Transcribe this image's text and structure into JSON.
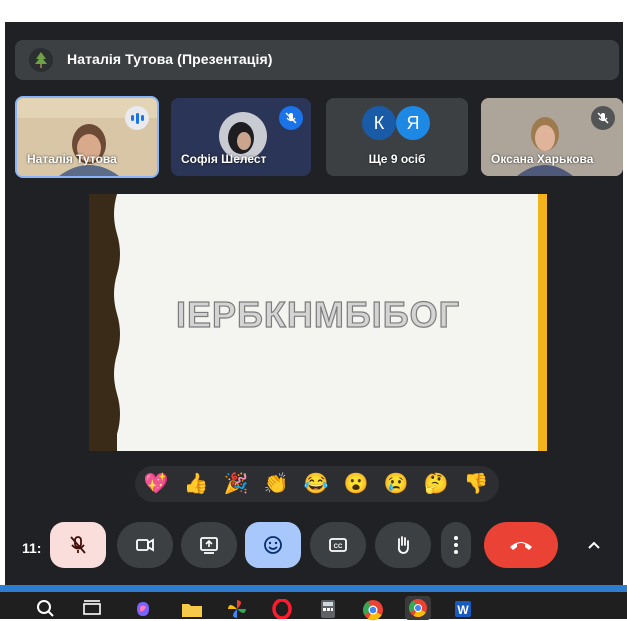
{
  "header": {
    "title": "Наталія Тутова (Презентація)",
    "presenter_icon": "tree-avatar-icon"
  },
  "participants": [
    {
      "name": "Наталія Тутова",
      "state": "speaking"
    },
    {
      "name": "Софія Шелест",
      "state": "muted"
    },
    {
      "name": "Ще 9 осіб",
      "avatars": [
        "К",
        "Я"
      ]
    },
    {
      "name": "Оксана Харькова",
      "state": "muted"
    }
  ],
  "slide": {
    "word": "ІЕРБКНМБІБОГ"
  },
  "reactions": [
    "💖",
    "👍",
    "🎉",
    "👏",
    "😂",
    "😮",
    "😢",
    "🤔",
    "👎"
  ],
  "controls": {
    "time": "11:",
    "buttons": [
      "mic-off-icon",
      "camera-icon",
      "present-screen-icon",
      "emoji-icon",
      "captions-icon",
      "raise-hand-icon",
      "more-options-icon",
      "end-call-icon",
      "chevron-up-icon"
    ]
  },
  "colors": {
    "background": "#202124",
    "accent_blue": "#8ab4f8",
    "end_call": "#ea4335",
    "mic_off_bg": "#f9dedc",
    "slide_accent": "#f2b31b"
  },
  "taskbar": {
    "icons": [
      "search-icon",
      "task-view-icon",
      "copilot-icon",
      "file-explorer-icon",
      "pinwheel-icon",
      "opera-icon",
      "calculator-icon",
      "chrome-icon",
      "chrome-active-icon",
      "word-icon"
    ]
  }
}
